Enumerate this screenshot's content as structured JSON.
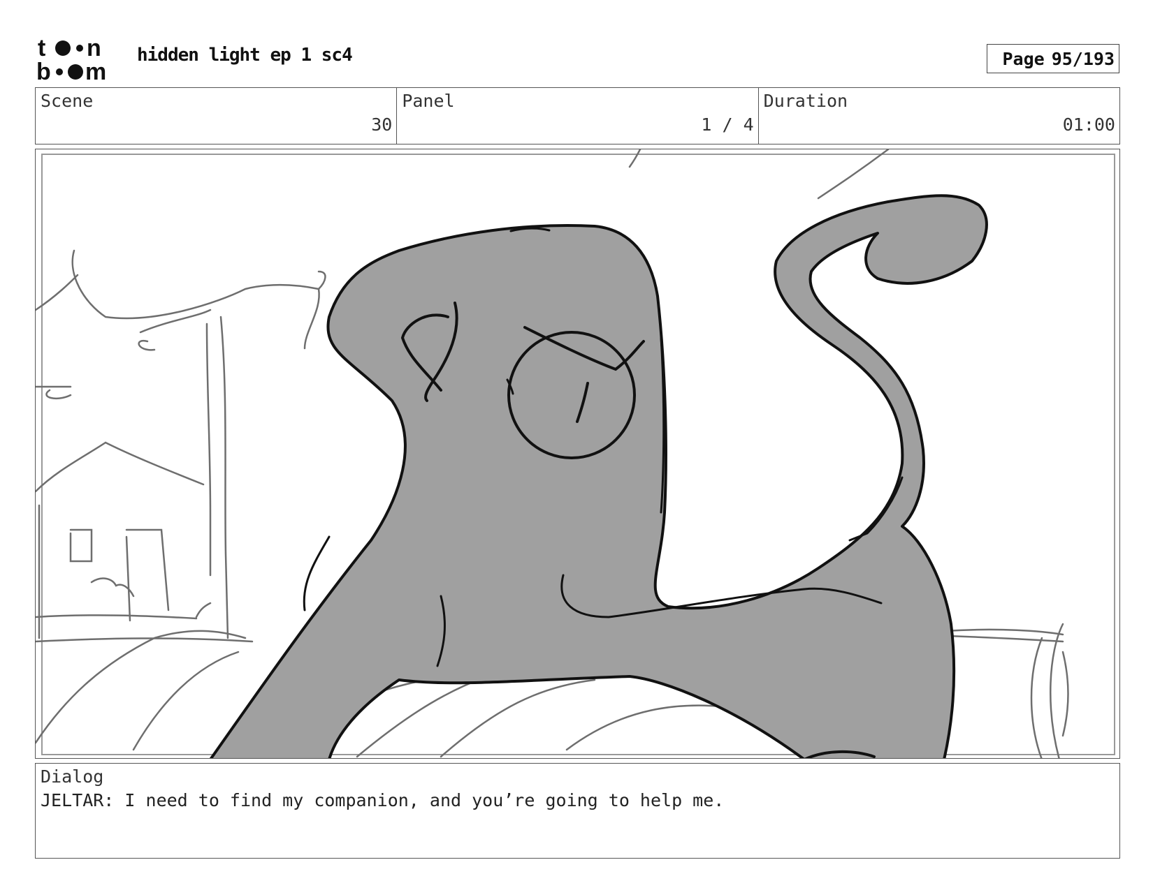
{
  "header": {
    "logo_text": "toon boom",
    "title": "hidden light ep 1 sc4",
    "page_label": "Page",
    "page_value": "95/193"
  },
  "info": {
    "scene_label": "Scene",
    "scene_value": "30",
    "panel_label": "Panel",
    "panel_value": "1 / 4",
    "duration_label": "Duration",
    "duration_value": "01:00"
  },
  "dialog": {
    "label": "Dialog",
    "text": "JELTAR: I need to find my companion, and you’re going to help me."
  },
  "colors": {
    "ink": "#111111",
    "fill": "#a0a0a0",
    "sketch": "#6e6e6e"
  }
}
